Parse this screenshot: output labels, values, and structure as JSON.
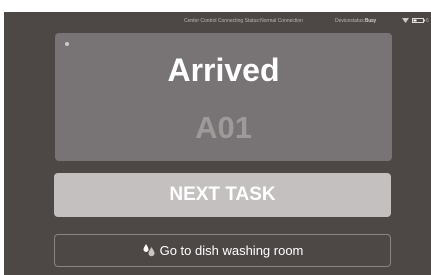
{
  "status_bar": {
    "center_control": "Center Control Connecting Status:Normal Connection",
    "device_label": "Devicestatus:",
    "device_value": "Busy",
    "wifi_icon": "wifi-icon",
    "battery_icon": "battery-icon",
    "battery_text": "6"
  },
  "panel": {
    "title": "Arrived",
    "location": "A01"
  },
  "next_task_label": "NEXT TASK",
  "destination": {
    "icon": "water-drops-icon",
    "label": "Go to dish washing room"
  },
  "colors": {
    "background": "#4d4846",
    "panel": "#787374",
    "button": "#c4c0bf"
  }
}
